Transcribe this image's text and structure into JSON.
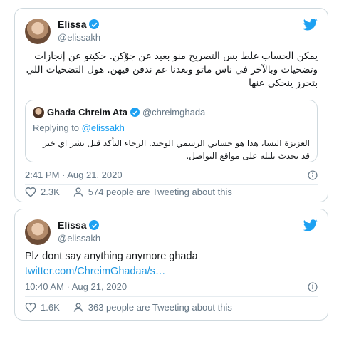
{
  "tweets": [
    {
      "name": "Elissa",
      "handle": "@elissakh",
      "text": "يمكن الحساب غلط بس التصريح منو بعيد عن جوّكن. حكيتو عن إنجازات وتضحيات وبالآخر في ناس ماتو وبعدنا عم ندفن فيهن. هول التضحيات اللي بتحرز ينحكى عنها",
      "quote": {
        "name": "Ghada Chreim Ata",
        "handle": "@chreimghada",
        "reply_prefix": "Replying to",
        "reply_handle": "@elissakh",
        "text": "العزيزة اليسا، هذا هو حسابي الرسمي الوحيد. الرجاء التأكد قبل نشر اي خبر قد يحدث بلبلة على مواقع التواصل."
      },
      "timestamp": "2:41 PM · Aug 21, 2020",
      "likes": "2.3K",
      "tweeting": "574 people are Tweeting about this"
    },
    {
      "name": "Elissa",
      "handle": "@elissakh",
      "text": "Plz dont say anything anymore ghada",
      "link": "twitter.com/ChreimGhadaa/s…",
      "timestamp": "10:40 AM · Aug 21, 2020",
      "likes": "1.6K",
      "tweeting": "363 people are Tweeting about this"
    }
  ],
  "icons": {
    "verified": "verified-badge-icon",
    "bird": "twitter-bird-icon",
    "info": "info-icon",
    "heart": "heart-icon",
    "people": "people-icon"
  },
  "colors": {
    "accent": "#1da1f2",
    "secondary_text": "#657786",
    "border": "#cfd9de"
  }
}
